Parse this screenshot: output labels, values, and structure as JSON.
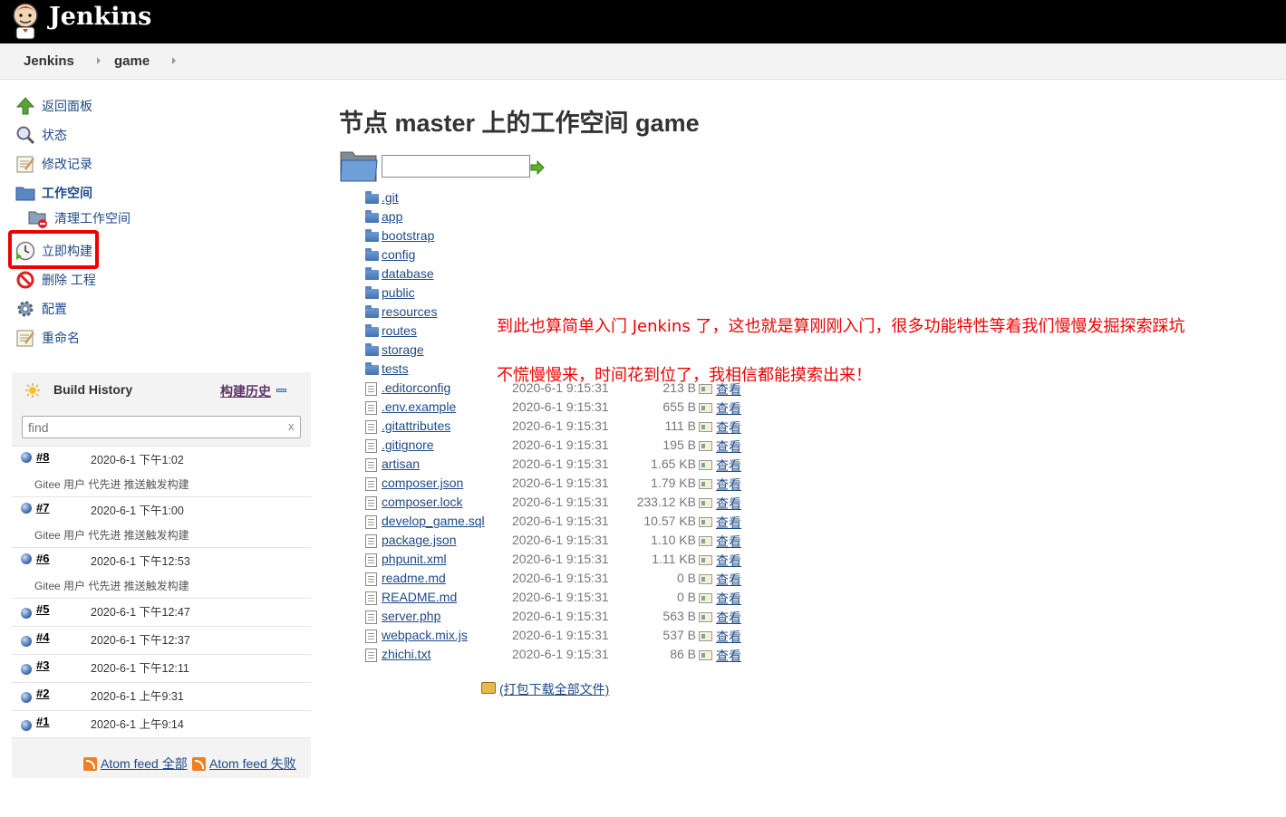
{
  "header": {
    "brand": "Jenkins"
  },
  "breadcrumb": [
    "Jenkins",
    "game"
  ],
  "side_tasks": [
    {
      "label": "返回面板",
      "icon": "up-arrow-icon"
    },
    {
      "label": "状态",
      "icon": "magnifier-icon"
    },
    {
      "label": "修改记录",
      "icon": "notepad-icon"
    },
    {
      "label": "工作空间",
      "icon": "folder-icon"
    },
    {
      "label": "清理工作空间",
      "icon": "folder-delete-icon"
    },
    {
      "label": "立即构建",
      "icon": "clock-build-icon"
    },
    {
      "label": "删除 工程",
      "icon": "no-entry-icon"
    },
    {
      "label": "配置",
      "icon": "gear-icon"
    },
    {
      "label": "重命名",
      "icon": "notepad-icon"
    }
  ],
  "build_history": {
    "title": "Build History",
    "trend_link": "构建历史",
    "search_placeholder": "find",
    "clear": "x",
    "builds": [
      {
        "num": "#8",
        "date": "2020-6-1 下午1:02",
        "desc": "Gitee 用户 代先进 推送触发构建"
      },
      {
        "num": "#7",
        "date": "2020-6-1 下午1:00",
        "desc": "Gitee 用户 代先进 推送触发构建"
      },
      {
        "num": "#6",
        "date": "2020-6-1 下午12:53",
        "desc": "Gitee 用户 代先进 推送触发构建"
      },
      {
        "num": "#5",
        "date": "2020-6-1 下午12:47",
        "desc": ""
      },
      {
        "num": "#4",
        "date": "2020-6-1 下午12:37",
        "desc": ""
      },
      {
        "num": "#3",
        "date": "2020-6-1 下午12:11",
        "desc": ""
      },
      {
        "num": "#2",
        "date": "2020-6-1 上午9:31",
        "desc": ""
      },
      {
        "num": "#1",
        "date": "2020-6-1 上午9:14",
        "desc": ""
      }
    ],
    "feed_all": "Atom feed 全部",
    "feed_fail": "Atom feed 失败"
  },
  "workspace": {
    "title": "节点 master 上的工作空间 game",
    "path_value": "",
    "folders": [
      ".git",
      "app",
      "bootstrap",
      "config",
      "database",
      "public",
      "resources",
      "routes",
      "storage",
      "tests"
    ],
    "files": [
      {
        "name": ".editorconfig",
        "date": "2020-6-1 9:15:31",
        "size": "213 B",
        "view": "查看"
      },
      {
        "name": ".env.example",
        "date": "2020-6-1 9:15:31",
        "size": "655 B",
        "view": "查看"
      },
      {
        "name": ".gitattributes",
        "date": "2020-6-1 9:15:31",
        "size": "111 B",
        "view": "查看"
      },
      {
        "name": ".gitignore",
        "date": "2020-6-1 9:15:31",
        "size": "195 B",
        "view": "查看"
      },
      {
        "name": "artisan",
        "date": "2020-6-1 9:15:31",
        "size": "1.65 KB",
        "view": "查看"
      },
      {
        "name": "composer.json",
        "date": "2020-6-1 9:15:31",
        "size": "1.79 KB",
        "view": "查看"
      },
      {
        "name": "composer.lock",
        "date": "2020-6-1 9:15:31",
        "size": "233.12 KB",
        "view": "查看"
      },
      {
        "name": "develop_game.sql",
        "date": "2020-6-1 9:15:31",
        "size": "10.57 KB",
        "view": "查看"
      },
      {
        "name": "package.json",
        "date": "2020-6-1 9:15:31",
        "size": "1.10 KB",
        "view": "查看"
      },
      {
        "name": "phpunit.xml",
        "date": "2020-6-1 9:15:31",
        "size": "1.11 KB",
        "view": "查看"
      },
      {
        "name": "readme.md",
        "date": "2020-6-1 9:15:31",
        "size": "0 B",
        "view": "查看"
      },
      {
        "name": "README.md",
        "date": "2020-6-1 9:15:31",
        "size": "0 B",
        "view": "查看"
      },
      {
        "name": "server.php",
        "date": "2020-6-1 9:15:31",
        "size": "563 B",
        "view": "查看"
      },
      {
        "name": "webpack.mix.js",
        "date": "2020-6-1 9:15:31",
        "size": "537 B",
        "view": "查看"
      },
      {
        "name": "zhichi.txt",
        "date": "2020-6-1 9:15:31",
        "size": "86 B",
        "view": "查看"
      }
    ],
    "zip_link": "(打包下载全部文件)"
  },
  "annotations": [
    "到此也算简单入门 Jenkins 了，这也就是算刚刚入门，很多功能特性等着我们慢慢发掘探索踩坑",
    "不慌慢慢来，时间花到位了，我相信都能摸索出来！"
  ],
  "colors": {
    "link": "#204a87",
    "annotation": "#ee0000",
    "highlight": "#ee0000"
  }
}
